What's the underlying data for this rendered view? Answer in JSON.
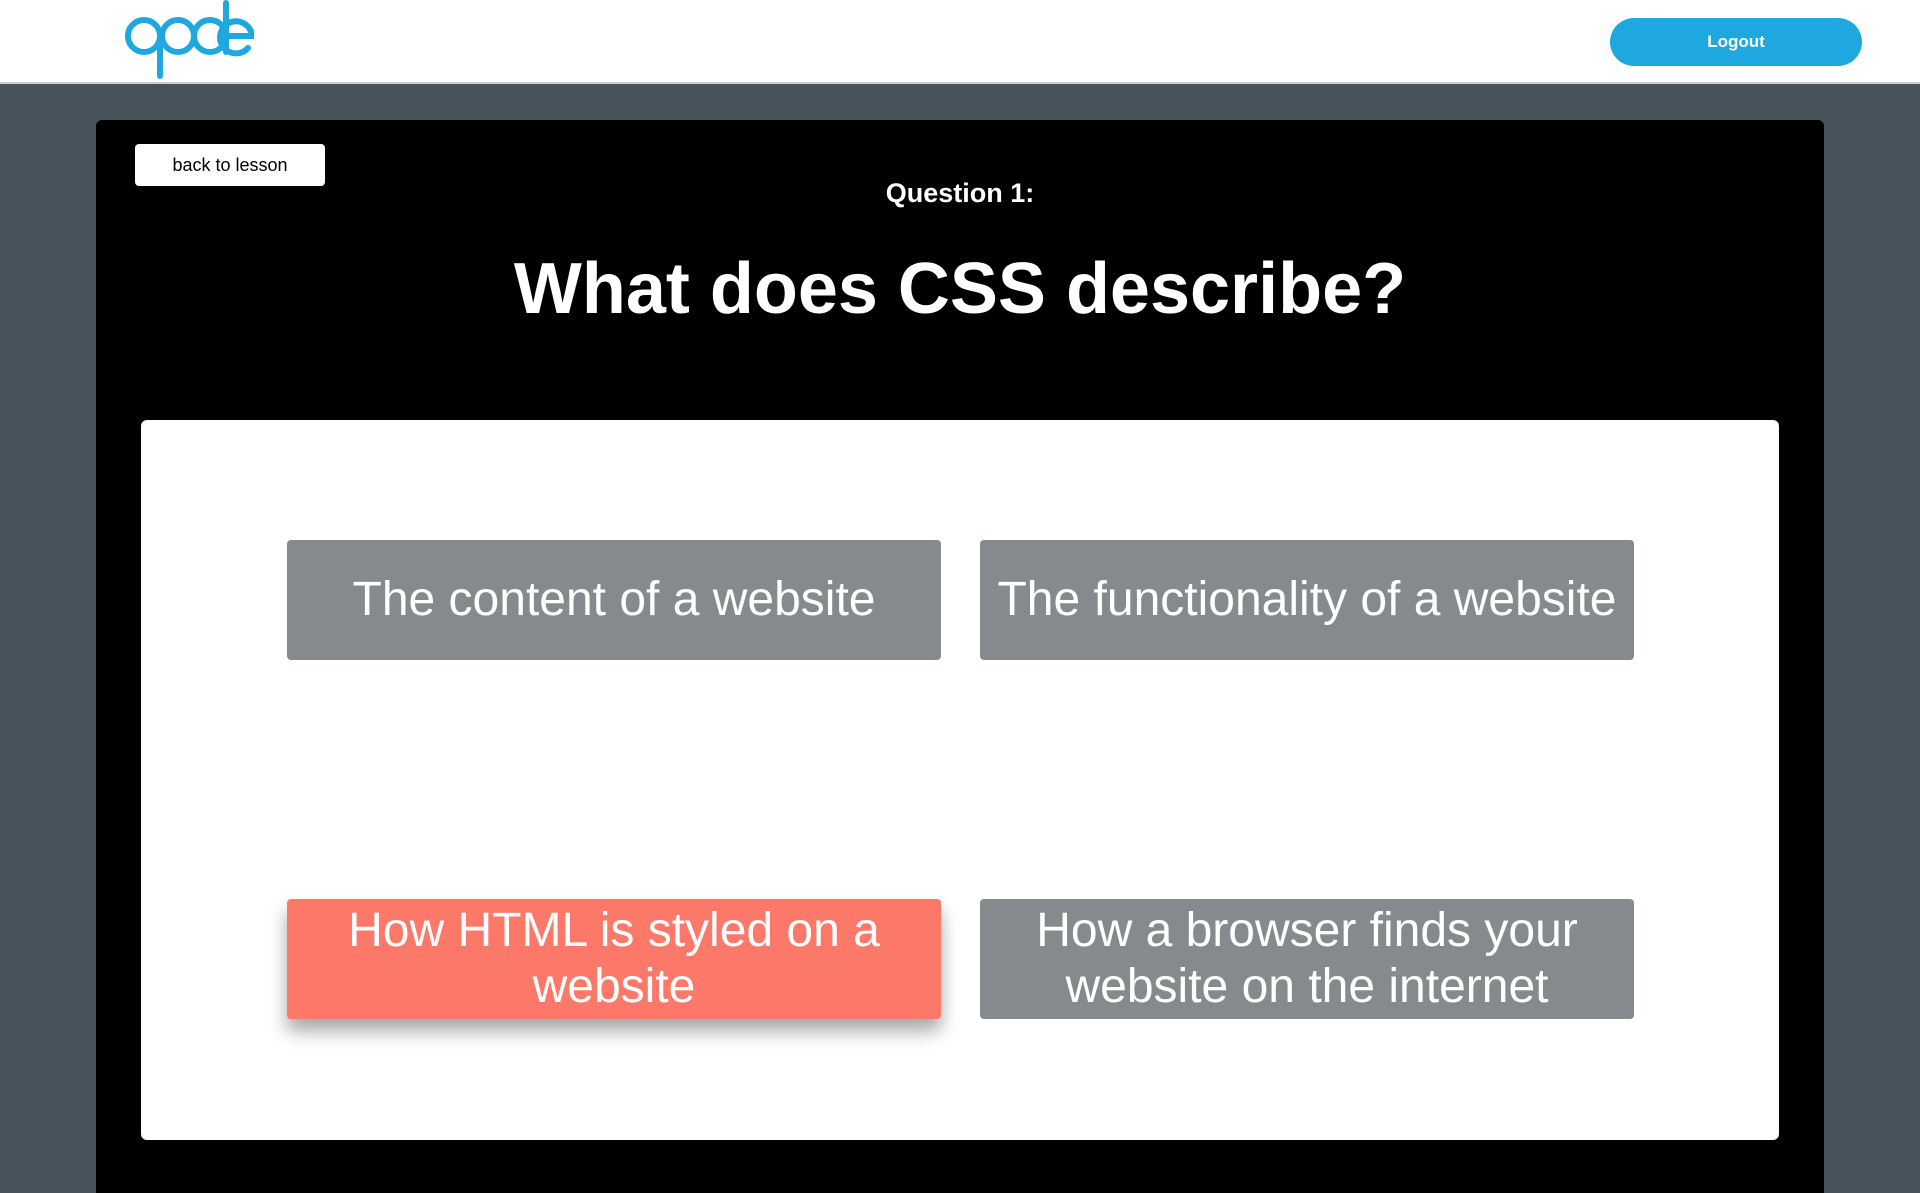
{
  "header": {
    "logo_name": "qode-logo",
    "logout_label": "Logout",
    "accent_color": "#1ea8df"
  },
  "quiz": {
    "back_label": "back to lesson",
    "question_number": "Question 1:",
    "question_text": "What does CSS describe?",
    "answers": [
      {
        "label": "The content of a website",
        "selected": false
      },
      {
        "label": "The functionality of a website",
        "selected": false
      },
      {
        "label": "How HTML is styled on a website",
        "selected": true
      },
      {
        "label": "How a browser finds your website on the internet",
        "selected": false
      }
    ],
    "colors": {
      "answer_default": "#858b8d",
      "answer_selected": "#fc7868",
      "panel": "#000000",
      "page_background": "#47545c"
    }
  }
}
